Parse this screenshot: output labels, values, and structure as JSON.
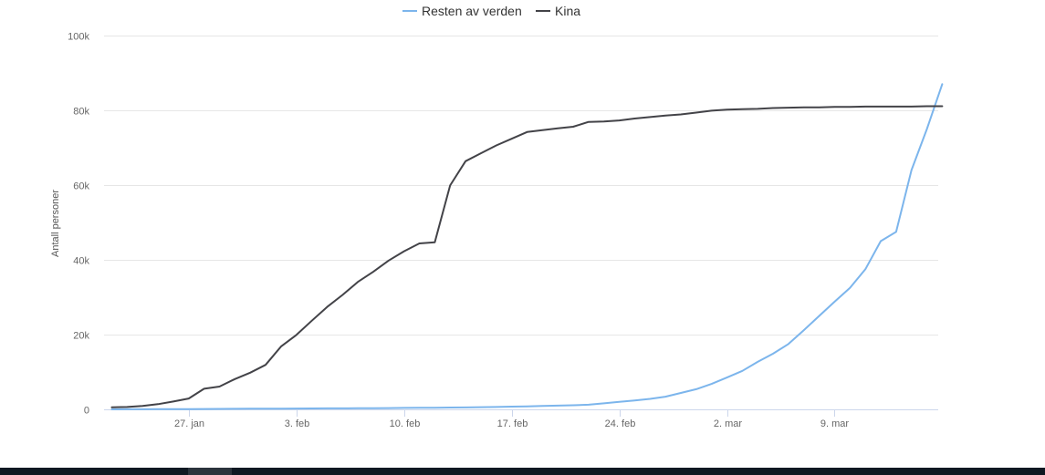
{
  "chart_data": {
    "type": "line",
    "title": "",
    "xlabel": "",
    "ylabel": "Antall personer",
    "x": [
      "22. jan",
      "23. jan",
      "24. jan",
      "25. jan",
      "26. jan",
      "27. jan",
      "28. jan",
      "29. jan",
      "30. jan",
      "31. jan",
      "1. feb",
      "2. feb",
      "3. feb",
      "4. feb",
      "5. feb",
      "6. feb",
      "7. feb",
      "8. feb",
      "9. feb",
      "10. feb",
      "11. feb",
      "12. feb",
      "13. feb",
      "14. feb",
      "15. feb",
      "16. feb",
      "17. feb",
      "18. feb",
      "19. feb",
      "20. feb",
      "21. feb",
      "22. feb",
      "23. feb",
      "24. feb",
      "25. feb",
      "26. feb",
      "27. feb",
      "28. feb",
      "29. feb",
      "1. mar",
      "2. mar",
      "3. mar",
      "4. mar",
      "5. mar",
      "6. mar",
      "7. mar",
      "8. mar",
      "9. mar",
      "10. mar",
      "11. mar",
      "12. mar",
      "13. mar",
      "14. mar",
      "15. mar"
    ],
    "x_ticks": [
      "27. jan",
      "3. feb",
      "10. feb",
      "17. feb",
      "24. feb",
      "2. mar",
      "9. mar"
    ],
    "ylim": [
      0,
      100000
    ],
    "y_ticks": [
      0,
      20000,
      40000,
      60000,
      80000,
      100000
    ],
    "y_tick_labels": [
      "0",
      "20k",
      "40k",
      "60k",
      "80k",
      "100k"
    ],
    "grid": true,
    "legend_position": "top-center",
    "series": [
      {
        "name": "Resten av verden",
        "color": "#7cb5ec",
        "values": [
          10,
          20,
          30,
          40,
          60,
          80,
          100,
          120,
          140,
          160,
          180,
          200,
          220,
          240,
          260,
          280,
          300,
          320,
          350,
          380,
          410,
          440,
          480,
          520,
          580,
          640,
          720,
          800,
          900,
          1000,
          1100,
          1250,
          1600,
          2000,
          2400,
          2800,
          3400,
          4400,
          5400,
          6800,
          8500,
          10300,
          12700,
          14900,
          17500,
          21200,
          25000,
          28800,
          32500,
          37500,
          45000,
          47500,
          64000,
          75000,
          87000
        ]
      },
      {
        "name": "Kina",
        "color": "#434348",
        "values": [
          550,
          640,
          920,
          1400,
          2100,
          2900,
          5500,
          6100,
          8100,
          9800,
          11900,
          16800,
          19900,
          23700,
          27400,
          30600,
          34100,
          36800,
          39800,
          42300,
          44400,
          44700,
          59900,
          66400,
          68500,
          70600,
          72400,
          74200,
          74700,
          75200,
          75600,
          76900,
          77000,
          77300,
          77800,
          78200,
          78600,
          78900,
          79400,
          79900,
          80200,
          80300,
          80400,
          80600,
          80700,
          80800,
          80800,
          80900,
          80900,
          81000,
          81000,
          81000,
          81000,
          81100,
          81100
        ]
      }
    ]
  }
}
